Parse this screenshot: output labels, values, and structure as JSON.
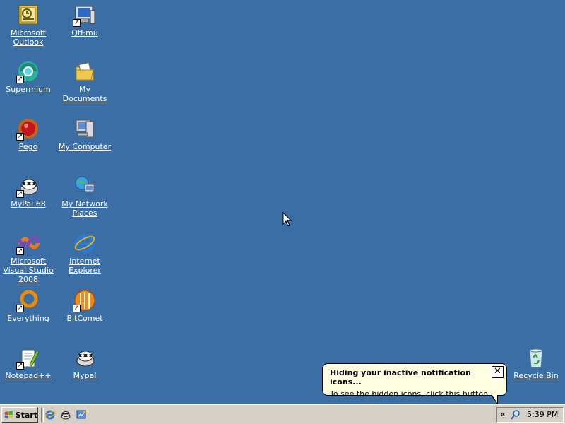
{
  "desktop": {
    "background": "#3a6ea5",
    "icons": [
      {
        "label": "Microsoft Outlook",
        "icon": "outlook-icon"
      },
      {
        "label": "QtEmu",
        "icon": "qtemu-icon"
      },
      {
        "label": "Supermium",
        "icon": "supermium-icon"
      },
      {
        "label": "My Documents",
        "icon": "my-documents-icon"
      },
      {
        "label": "Pego",
        "icon": "pego-icon"
      },
      {
        "label": "My Computer",
        "icon": "my-computer-icon"
      },
      {
        "label": "MyPal 68",
        "icon": "mypal-icon"
      },
      {
        "label": "My Network Places",
        "icon": "network-places-icon"
      },
      {
        "label": "Microsoft Visual Studio 2008",
        "icon": "visual-studio-icon"
      },
      {
        "label": "Internet Explorer",
        "icon": "internet-explorer-icon"
      },
      {
        "label": "Everything",
        "icon": "everything-icon"
      },
      {
        "label": "BitComet",
        "icon": "bitcomet-icon"
      },
      {
        "label": "Notepad++",
        "icon": "notepadpp-icon"
      },
      {
        "label": "Mypal",
        "icon": "mypal-icon"
      },
      {
        "label": "Recycle Bin",
        "icon": "recycle-bin-icon"
      }
    ]
  },
  "balloon": {
    "title": "Hiding your inactive notification icons...",
    "text": "To see the hidden icons, click this button.",
    "close_symbol": "✕"
  },
  "taskbar": {
    "start_label": "Start",
    "quick_launch": [
      "internet-explorer-icon",
      "mypal-icon",
      "show-desktop-icon"
    ],
    "tray_expand": "«",
    "tray_icons": [
      "search-icon"
    ],
    "clock": "5:39 PM"
  }
}
